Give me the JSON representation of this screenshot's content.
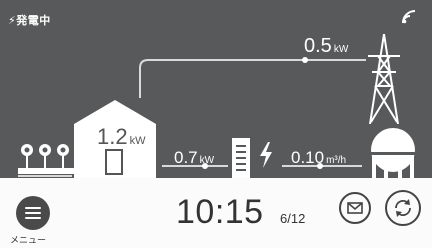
{
  "status": {
    "text": "⚡発電中"
  },
  "flows": {
    "grid": {
      "value": "0.5",
      "unit": "kW"
    },
    "house": {
      "value": "1.2",
      "unit": "kW"
    },
    "meter": {
      "value": "0.7",
      "unit": "kW"
    },
    "gas": {
      "value": "0.10",
      "unit": "m³/h"
    }
  },
  "footer": {
    "menu_label": "メニュー",
    "time": "10:15",
    "date": "6/12"
  },
  "icons": [
    "wifi-icon",
    "menu-icon",
    "mail-icon",
    "sync-icon",
    "house-icon",
    "tower-icon",
    "gas-tank-icon",
    "flower-icon",
    "lightning-icon"
  ],
  "colors": {
    "panel_bg": "#58595b",
    "footer_bg": "#fbfbfb",
    "line": "#d9d9d9"
  }
}
